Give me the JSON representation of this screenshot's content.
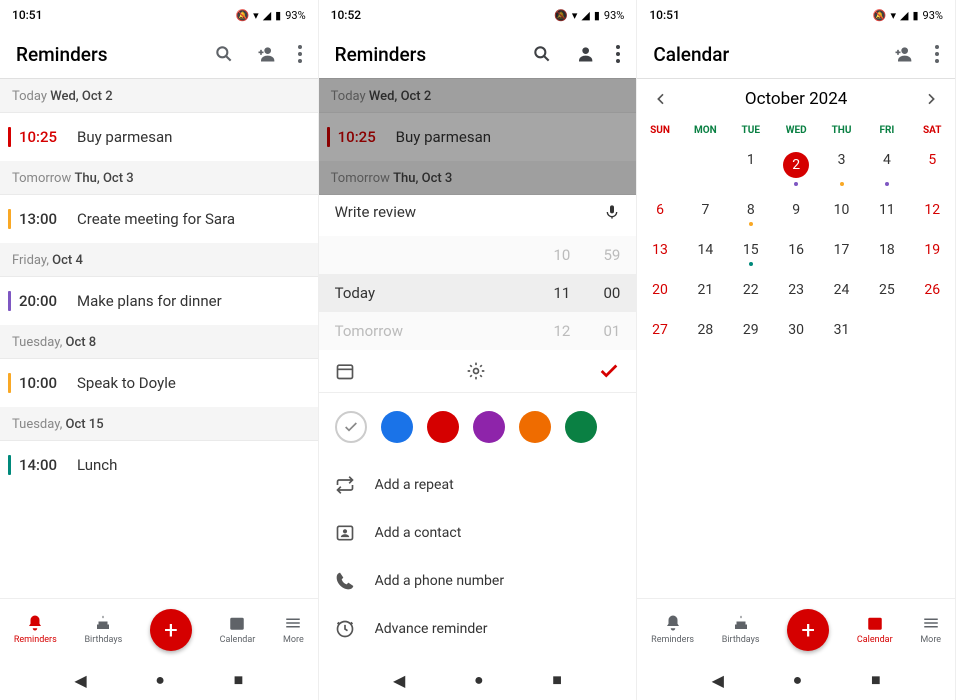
{
  "pane1": {
    "status": {
      "time": "10:51",
      "battery": "93%"
    },
    "title": "Reminders",
    "sections": [
      {
        "label_grey": "Today ",
        "label_bold": "Wed, Oct 2",
        "items": [
          {
            "bar": "#d50000",
            "time": "10:25",
            "time_color": "#d50000",
            "title": "Buy parmesan"
          }
        ]
      },
      {
        "label_grey": "Tomorrow ",
        "label_bold": "Thu, Oct 3",
        "items": [
          {
            "bar": "#f9a825",
            "time": "13:00",
            "time_color": "#333",
            "title": "Create meeting for Sara"
          }
        ]
      },
      {
        "label_grey": "Friday, ",
        "label_bold": "Oct 4",
        "items": [
          {
            "bar": "#7e57c2",
            "time": "20:00",
            "time_color": "#333",
            "title": "Make plans for dinner"
          }
        ]
      },
      {
        "label_grey": "Tuesday, ",
        "label_bold": "Oct 8",
        "items": [
          {
            "bar": "#f9a825",
            "time": "10:00",
            "time_color": "#333",
            "title": "Speak to Doyle"
          }
        ]
      },
      {
        "label_grey": "Tuesday, ",
        "label_bold": "Oct 15",
        "items": [
          {
            "bar": "#00897b",
            "time": "14:00",
            "time_color": "#333",
            "title": "Lunch"
          }
        ]
      }
    ],
    "nav": {
      "reminders": "Reminders",
      "birthdays": "Birthdays",
      "calendar": "Calendar",
      "more": "More"
    }
  },
  "pane2": {
    "status": {
      "time": "10:52",
      "battery": "93%"
    },
    "title": "Reminders",
    "bg_sections": [
      {
        "label_grey": "Today ",
        "label_bold": "Wed, Oct 2",
        "items": [
          {
            "bar": "#d50000",
            "time": "10:25",
            "time_color": "#d50000",
            "title": "Buy parmesan"
          }
        ]
      },
      {
        "label_grey": "Tomorrow ",
        "label_bold": "Thu, Oct 3",
        "items": []
      }
    ],
    "sheet": {
      "input": "Write review",
      "picker": [
        {
          "label": "",
          "hour": "10",
          "min": "59",
          "style": "faded"
        },
        {
          "label": "Today",
          "hour": "11",
          "min": "00",
          "style": "selected"
        },
        {
          "label": "Tomorrow",
          "hour": "12",
          "min": "01",
          "style": "faded"
        }
      ],
      "colors": [
        "#1a73e8",
        "#d50000",
        "#8e24aa",
        "#ef6c00",
        "#0a8043"
      ],
      "options": [
        {
          "icon": "repeat",
          "label": "Add a repeat"
        },
        {
          "icon": "contact",
          "label": "Add a contact"
        },
        {
          "icon": "phone",
          "label": "Add a phone number"
        },
        {
          "icon": "advance",
          "label": "Advance reminder"
        }
      ]
    }
  },
  "pane3": {
    "status": {
      "time": "10:51",
      "battery": "93%"
    },
    "title": "Calendar",
    "month": "October 2024",
    "dow": [
      "SUN",
      "MON",
      "TUE",
      "WED",
      "THU",
      "FRI",
      "SAT"
    ],
    "days": [
      {
        "n": "",
        "w": true
      },
      {
        "n": "",
        "w": false
      },
      {
        "n": "1",
        "w": false
      },
      {
        "n": "2",
        "w": false,
        "today": true,
        "dot": "#7e57c2"
      },
      {
        "n": "3",
        "w": false,
        "dot": "#f9a825"
      },
      {
        "n": "4",
        "w": false,
        "dot": "#7e57c2"
      },
      {
        "n": "5",
        "w": true
      },
      {
        "n": "6",
        "w": true
      },
      {
        "n": "7",
        "w": false
      },
      {
        "n": "8",
        "w": false,
        "dot": "#f9a825"
      },
      {
        "n": "9",
        "w": false
      },
      {
        "n": "10",
        "w": false
      },
      {
        "n": "11",
        "w": false
      },
      {
        "n": "12",
        "w": true
      },
      {
        "n": "13",
        "w": true
      },
      {
        "n": "14",
        "w": false
      },
      {
        "n": "15",
        "w": false,
        "dot": "#00897b"
      },
      {
        "n": "16",
        "w": false
      },
      {
        "n": "17",
        "w": false
      },
      {
        "n": "18",
        "w": false
      },
      {
        "n": "19",
        "w": true
      },
      {
        "n": "20",
        "w": true
      },
      {
        "n": "21",
        "w": false
      },
      {
        "n": "22",
        "w": false
      },
      {
        "n": "23",
        "w": false
      },
      {
        "n": "24",
        "w": false
      },
      {
        "n": "25",
        "w": false
      },
      {
        "n": "26",
        "w": true
      },
      {
        "n": "27",
        "w": true
      },
      {
        "n": "28",
        "w": false
      },
      {
        "n": "29",
        "w": false
      },
      {
        "n": "30",
        "w": false
      },
      {
        "n": "31",
        "w": false
      },
      {
        "n": "",
        "w": false
      },
      {
        "n": "",
        "w": true
      }
    ],
    "nav": {
      "reminders": "Reminders",
      "birthdays": "Birthdays",
      "calendar": "Calendar",
      "more": "More"
    }
  }
}
